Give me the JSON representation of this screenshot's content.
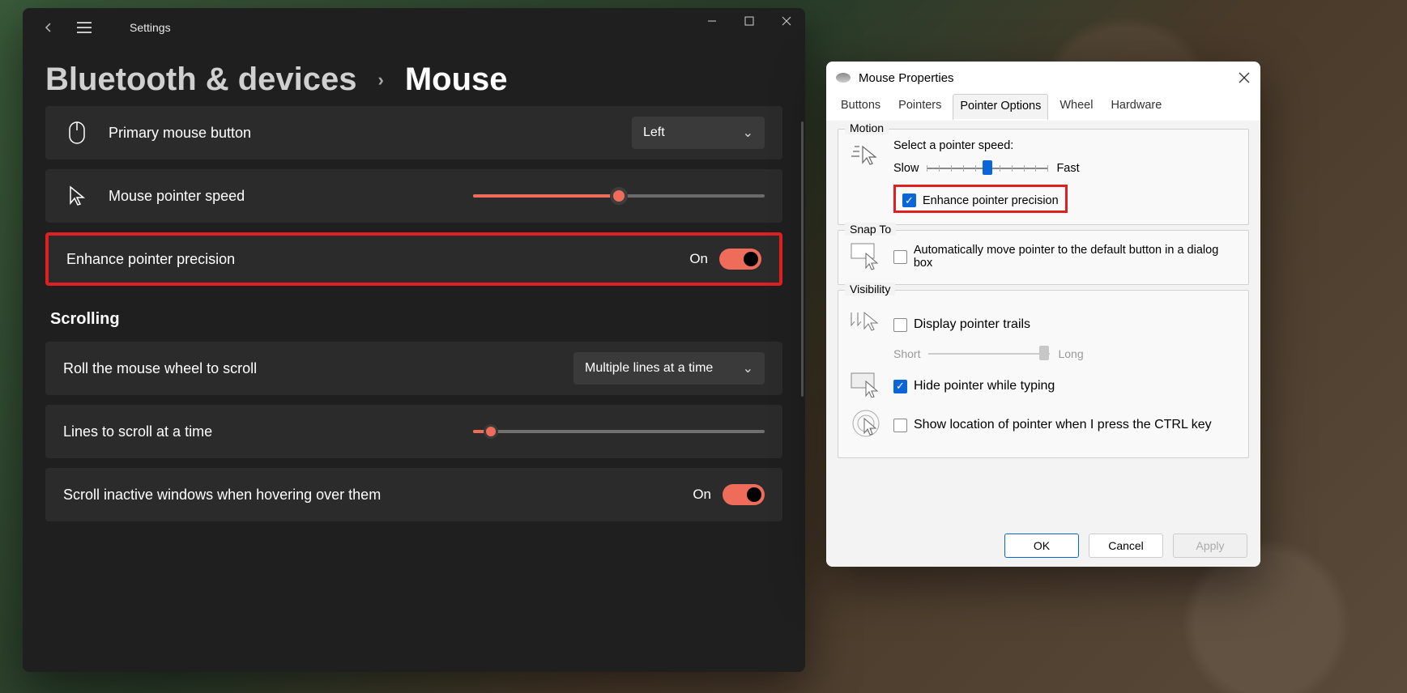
{
  "settings": {
    "appTitle": "Settings",
    "breadcrumb": {
      "parent": "Bluetooth & devices",
      "current": "Mouse"
    },
    "primaryButton": {
      "label": "Primary mouse button",
      "value": "Left"
    },
    "pointerSpeed": {
      "label": "Mouse pointer speed",
      "percent": 50
    },
    "enhancePrecision": {
      "label": "Enhance pointer precision",
      "stateText": "On",
      "on": true
    },
    "scrollingHeader": "Scrolling",
    "rollWheel": {
      "label": "Roll the mouse wheel to scroll",
      "value": "Multiple lines at a time"
    },
    "linesToScroll": {
      "label": "Lines to scroll at a time",
      "percent": 6
    },
    "scrollInactive": {
      "label": "Scroll inactive windows when hovering over them",
      "stateText": "On",
      "on": true
    }
  },
  "dialog": {
    "title": "Mouse Properties",
    "tabs": [
      "Buttons",
      "Pointers",
      "Pointer Options",
      "Wheel",
      "Hardware"
    ],
    "activeTab": "Pointer Options",
    "motion": {
      "groupTitle": "Motion",
      "selectLabel": "Select a pointer speed:",
      "slow": "Slow",
      "fast": "Fast",
      "sliderPercent": 50,
      "enhanceLabel": "Enhance pointer precision",
      "enhanceChecked": true
    },
    "snapTo": {
      "groupTitle": "Snap To",
      "label": "Automatically move pointer to the default button in a dialog box",
      "checked": false
    },
    "visibility": {
      "groupTitle": "Visibility",
      "trails": {
        "label": "Display pointer trails",
        "checked": false,
        "short": "Short",
        "long": "Long",
        "sliderPercent": 95
      },
      "hideTyping": {
        "label": "Hide pointer while typing",
        "checked": true
      },
      "showCtrl": {
        "label": "Show location of pointer when I press the CTRL key",
        "checked": false
      }
    },
    "buttons": {
      "ok": "OK",
      "cancel": "Cancel",
      "apply": "Apply"
    }
  }
}
